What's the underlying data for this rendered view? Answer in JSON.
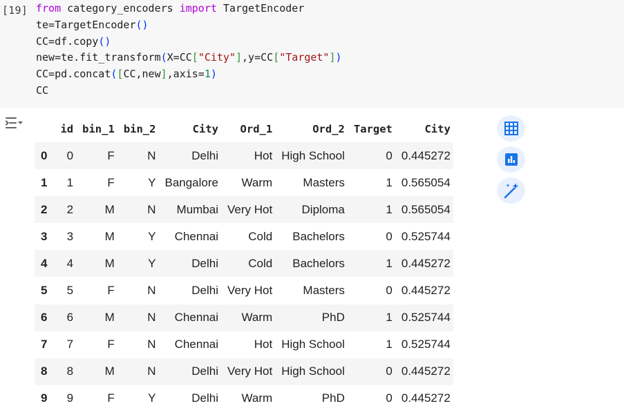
{
  "cell": {
    "execution_count": "[19]",
    "code_lines": [
      "from category_encoders import TargetEncoder",
      "te=TargetEncoder()",
      "CC=df.copy()",
      "new=te.fit_transform(X=CC[\"City\"],y=CC[\"Target\"])",
      "CC=pd.concat([CC,new],axis=1)",
      "CC"
    ]
  },
  "output": {
    "toggle_icon": "output-toggle-icon",
    "columns": [
      "",
      "id",
      "bin_1",
      "bin_2",
      "City",
      "Ord_1",
      "Ord_2",
      "Target",
      "City"
    ],
    "rows": [
      {
        "index": "0",
        "cells": [
          "0",
          "F",
          "N",
          "Delhi",
          "Hot",
          "High School",
          "0",
          "0.445272"
        ]
      },
      {
        "index": "1",
        "cells": [
          "1",
          "F",
          "Y",
          "Bangalore",
          "Warm",
          "Masters",
          "1",
          "0.565054"
        ]
      },
      {
        "index": "2",
        "cells": [
          "2",
          "M",
          "N",
          "Mumbai",
          "Very Hot",
          "Diploma",
          "1",
          "0.565054"
        ]
      },
      {
        "index": "3",
        "cells": [
          "3",
          "M",
          "Y",
          "Chennai",
          "Cold",
          "Bachelors",
          "0",
          "0.525744"
        ]
      },
      {
        "index": "4",
        "cells": [
          "4",
          "M",
          "Y",
          "Delhi",
          "Cold",
          "Bachelors",
          "1",
          "0.445272"
        ]
      },
      {
        "index": "5",
        "cells": [
          "5",
          "F",
          "N",
          "Delhi",
          "Very Hot",
          "Masters",
          "0",
          "0.445272"
        ]
      },
      {
        "index": "6",
        "cells": [
          "6",
          "M",
          "N",
          "Chennai",
          "Warm",
          "PhD",
          "1",
          "0.525744"
        ]
      },
      {
        "index": "7",
        "cells": [
          "7",
          "F",
          "N",
          "Chennai",
          "Hot",
          "High School",
          "1",
          "0.525744"
        ]
      },
      {
        "index": "8",
        "cells": [
          "8",
          "M",
          "N",
          "Delhi",
          "Very Hot",
          "High School",
          "0",
          "0.445272"
        ]
      },
      {
        "index": "9",
        "cells": [
          "9",
          "F",
          "Y",
          "Delhi",
          "Warm",
          "PhD",
          "0",
          "0.445272"
        ]
      }
    ],
    "side_buttons": [
      {
        "icon": "table-icon",
        "color": "#1a73e8"
      },
      {
        "icon": "bar-chart-icon",
        "color": "#1a73e8"
      },
      {
        "icon": "magic-wand-icon",
        "color": "#1a73e8"
      }
    ]
  },
  "colors": {
    "code_background": "#f7f7f7",
    "keyword": "#af00db",
    "string": "#a31515",
    "number": "#098658",
    "accent": "#1a73e8",
    "row_stripe": "#f5f5f5"
  }
}
